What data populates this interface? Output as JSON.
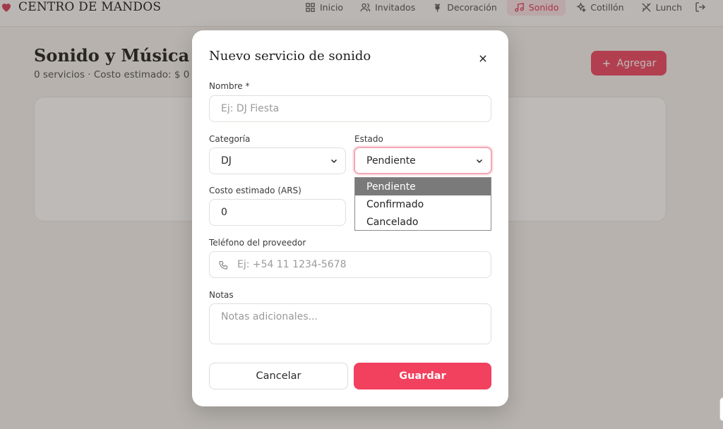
{
  "app": {
    "brand_name": "CENTRO DE MANDOS",
    "nav": [
      {
        "label": "Inicio",
        "icon": "grid-icon"
      },
      {
        "label": "Invitados",
        "icon": "users-icon"
      },
      {
        "label": "Decoración",
        "icon": "flower-icon"
      },
      {
        "label": "Sonido",
        "icon": "music-icon",
        "active": true
      },
      {
        "label": "Cotillón",
        "icon": "sparkles-icon"
      },
      {
        "label": "Lunch",
        "icon": "utensils-icon"
      }
    ],
    "logout_icon": "logout-icon"
  },
  "page": {
    "title": "Sonido y Música",
    "subtitle": "0 servicios · Costo estimado: $ 0",
    "add_label": "Agregar"
  },
  "modal": {
    "title": "Nuevo servicio de sonido",
    "fields": {
      "name_label": "Nombre *",
      "name_placeholder": "Ej: DJ Fiesta",
      "category_label": "Categoría",
      "category_value": "DJ",
      "status_label": "Estado",
      "status_value": "Pendiente",
      "status_options": [
        "Pendiente",
        "Confirmado",
        "Cancelado"
      ],
      "cost_label": "Costo estimado (ARS)",
      "cost_value": "0",
      "phone_label": "Teléfono del proveedor",
      "phone_placeholder": "Ej: +54 11 1234-5678",
      "notes_label": "Notas",
      "notes_placeholder": "Notas adicionales..."
    },
    "cancel_label": "Cancelar",
    "save_label": "Guardar"
  },
  "colors": {
    "accent": "#ef4a68",
    "active_nav_bg": "#fbe3e7",
    "overlay": "rgba(50,40,30,0.32)"
  }
}
